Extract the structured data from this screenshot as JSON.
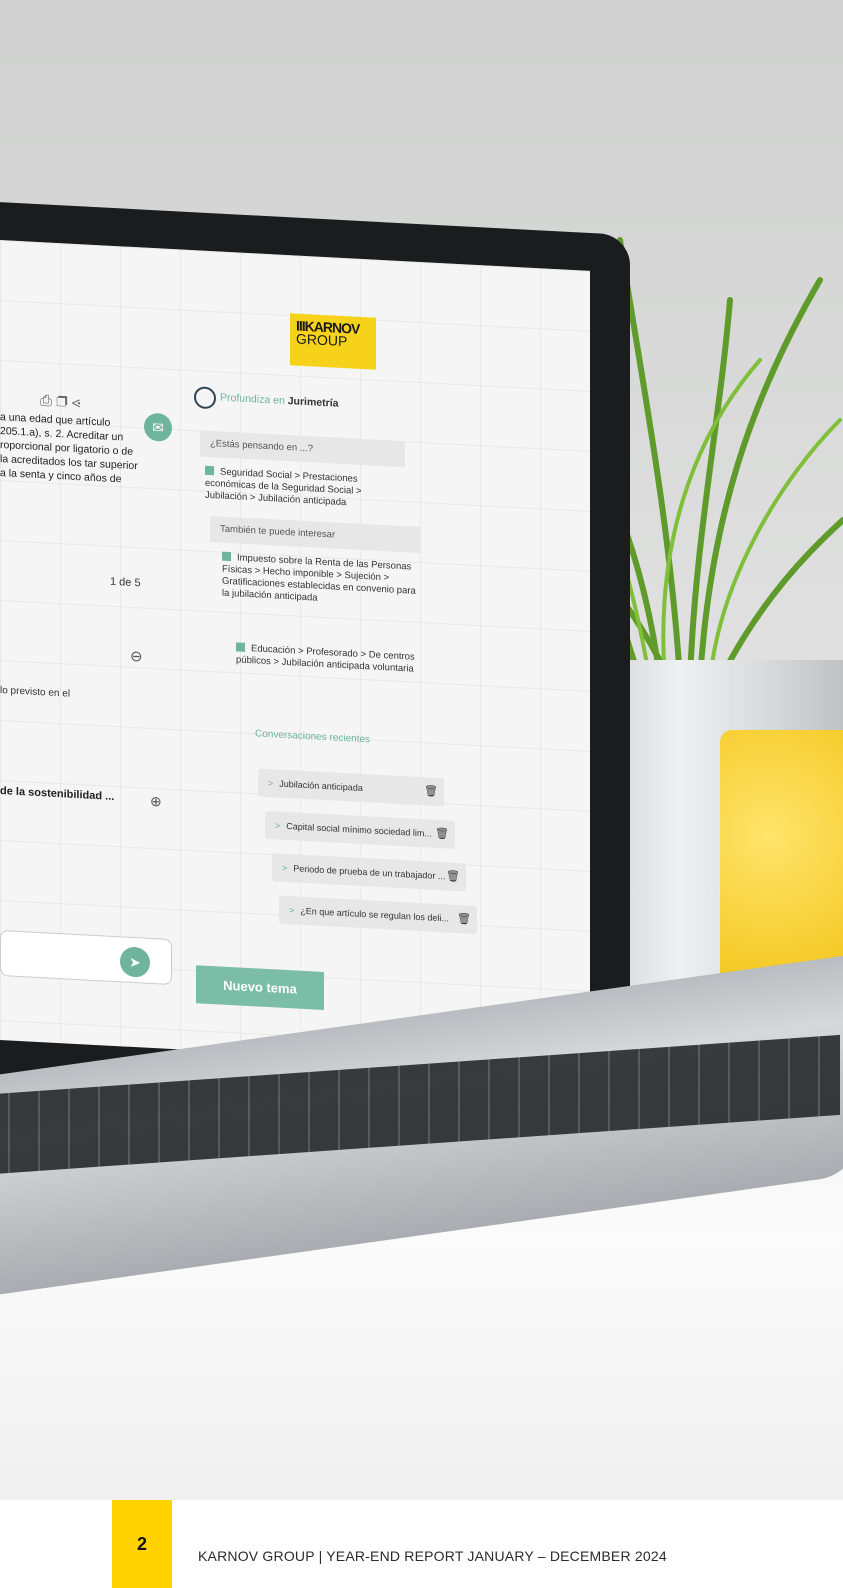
{
  "screen": {
    "logo_line1": "IIIKARNOV",
    "logo_line2": "GROUP",
    "toolbar_icons": [
      "print-icon",
      "copy-icon",
      "share-icon"
    ],
    "answer_text": "a una edad que artículo 205.1.a), s. 2. Acreditar un roporcional por ligatorio o de la acreditados los tar superior a la senta y cinco años de",
    "counter": "1 de 5",
    "prev_text": "lo previsto en el",
    "sost_text": "de la sostenibilidad ...",
    "deep_prefix": "Profundiza en",
    "deep_brand": "Jurimetría",
    "thinking_label": "¿Estás pensando en ...?",
    "topic1": "Seguridad Social > Prestaciones económicas de la Seguridad Social > Jubilación > Jubilación anticipada",
    "interest_label": "También te puede interesar",
    "topic2": "Impuesto sobre la Renta de las Personas Físicas > Hecho imponible > Sujeción > Gratificaciones establecidas en convenio para la jubilación anticipada",
    "topic3": "Educación > Profesorado > De centros públicos > Jubilación anticipada voluntaria",
    "recent_title": "Conversaciones recientes",
    "recent": [
      "Jubilación anticipada",
      "Capital social mínimo sociedad lim...",
      "Periodo de prueba de un trabajador ...",
      "¿En que artículo se regulan los deli..."
    ],
    "new_topic": "Nuevo tema"
  },
  "footer": {
    "page_number": "2",
    "text": "KARNOV GROUP | YEAR-END REPORT JANUARY – DECEMBER 2024"
  },
  "colors": {
    "accent_yellow": "#ffd200",
    "accent_green": "#6fb49c"
  }
}
